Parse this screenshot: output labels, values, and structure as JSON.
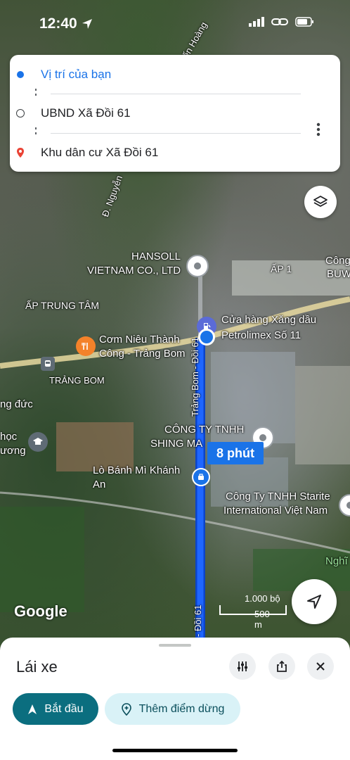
{
  "status_bar": {
    "time": "12:40"
  },
  "route": {
    "origin": "Vị trí của bạn",
    "stop": "UBND Xã Đồi 61",
    "destination": "Khu dân cư Xã Đồi 61"
  },
  "map": {
    "labels": {
      "hansoll_1": "HANSOLL",
      "hansoll_2": "VIETNAM CO., LTD",
      "ap1": "ẤP 1",
      "cong": "Công",
      "buw": "BUW",
      "ap_trung_tam": "ẤP TRUNG TÂM",
      "cuahang_1": "Cửa hàng Xăng dầu",
      "cuahang_2": "Petrolimex Số 11",
      "com_1": "Cơm Niêu Thành",
      "com_2": "Công - Trảng Bom",
      "trang_bom": "TRẢNG BOM",
      "ng_duc": "ng đức",
      "hoc": "học",
      "uong": "ương",
      "shing_1": "CÔNG TY TNHH",
      "shing_2": "SHING MA",
      "banh_mi_1": "Lò Bánh Mì Khánh",
      "banh_mi_2": "An",
      "starite_1": "Công Ty TNHH Starite",
      "starite_2": "International Việt Nam",
      "nghi": "Nghĩ",
      "road_trang_bom": "Trảng Bom - Đồi 61",
      "road_doi61": "- Đồi 61",
      "road_nguyen": "Đ. Nguyễn",
      "road_top": "iến Hoàng"
    },
    "eta": "8 phút",
    "google": "Google",
    "scale_top": "1.000 bộ",
    "scale_bottom": "500 m"
  },
  "sheet": {
    "title": "Lái xe",
    "start_label": "Bắt đầu",
    "add_stop_label": "Thêm điểm dừng"
  }
}
